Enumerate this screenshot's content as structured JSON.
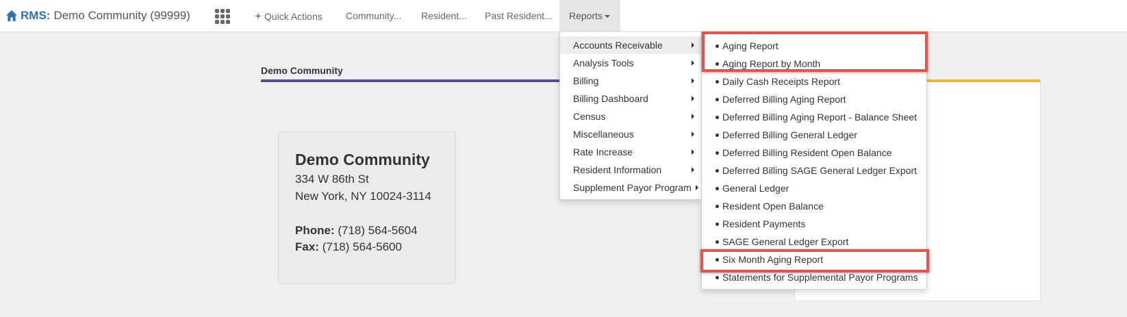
{
  "brand": {
    "prefix": "RMS:",
    "community": "Demo Community (99999)"
  },
  "nav": {
    "quick_actions": "Quick Actions",
    "community": "Community...",
    "resident": "Resident...",
    "past_resident": "Past Resident...",
    "reports": "Reports"
  },
  "section": {
    "title": "Demo Community"
  },
  "card": {
    "name": "Demo Community",
    "street": "334 W 86th St",
    "city_line": "New York, NY 10024-3114",
    "phone_label": "Phone:",
    "phone": "(718) 564-5604",
    "fax_label": "Fax:",
    "fax": "(718) 564-5600"
  },
  "reports_menu": {
    "items": [
      "Accounts Receivable",
      "Analysis Tools",
      "Billing",
      "Billing Dashboard",
      "Census",
      "Miscellaneous",
      "Rate Increase",
      "Resident Information",
      "Supplement Payor Program"
    ],
    "active": "Accounts Receivable"
  },
  "ar_submenu": {
    "items": [
      "Aging Report",
      "Aging Report by Month",
      "Daily Cash Receipts Report",
      "Deferred Billing Aging Report",
      "Deferred Billing Aging Report - Balance Sheet",
      "Deferred Billing General Ledger",
      "Deferred Billing Resident Open Balance",
      "Deferred Billing SAGE General Ledger Export",
      "General Ledger",
      "Resident Open Balance",
      "Resident Payments",
      "SAGE General Ledger Export",
      "Six Month Aging Report",
      "Statements for Supplemental Payor Programs"
    ],
    "highlighted": [
      "Aging Report",
      "Aging Report by Month",
      "Six Month Aging Report"
    ]
  },
  "colors": {
    "brand_blue": "#2b70b4",
    "purple_rule": "#5a4a8c",
    "orange_rule": "#f5b335",
    "highlight_red": "#e5534b"
  },
  "icons": {
    "home": "home-icon",
    "apps": "grid-icon",
    "add": "plus-icon",
    "dropdown": "caret-down-icon",
    "submenu": "caret-right-icon"
  }
}
